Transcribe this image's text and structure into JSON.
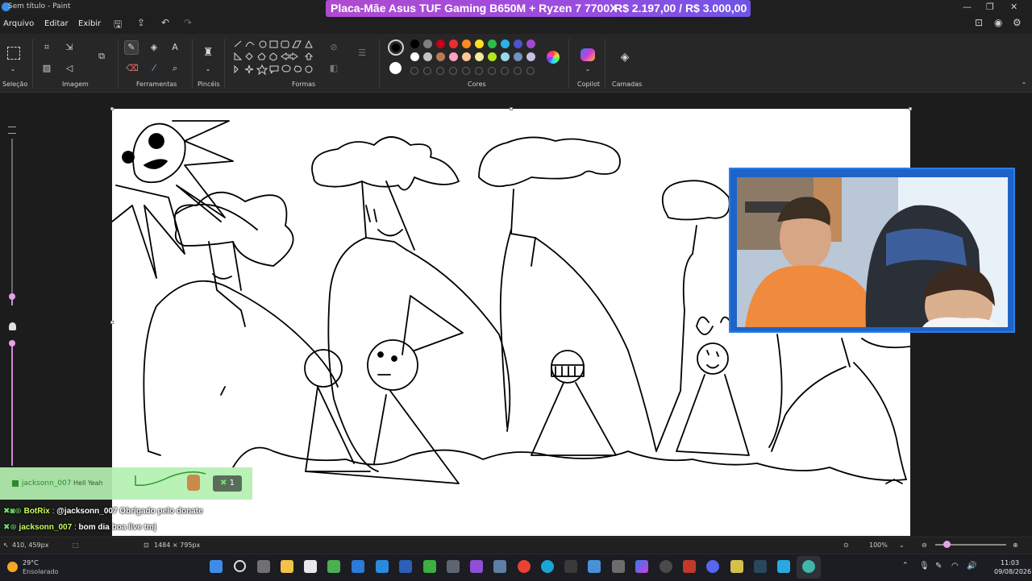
{
  "window": {
    "title": "Sem título - Paint",
    "promo_title": "Placa-Mãe Asus TUF Gaming B650M + Ryzen 7 7700X",
    "promo_price": "R$ 2.197,00 / R$ 3.000,00",
    "controls": [
      "—",
      "❐",
      "✕"
    ]
  },
  "menu": [
    "Arquivo",
    "Editar",
    "Exibir"
  ],
  "ribbon": {
    "groups": [
      "Seleção",
      "Imagem",
      "Ferramentas",
      "Pincéis",
      "Formas",
      "Cores",
      "Copilot",
      "Camadas"
    ]
  },
  "colors": {
    "primary": "#000000",
    "secondary": "#ffffff",
    "palette_row1": [
      "#000000",
      "#7f7f7f",
      "#c3001a",
      "#ef2b32",
      "#ff8a1f",
      "#ffe11a",
      "#2bbf4a",
      "#2ab3e6",
      "#4b53cf",
      "#a04ad0"
    ],
    "palette_row2": [
      "#ffffff",
      "#c3c3c3",
      "#b97a57",
      "#ff9fc3",
      "#ffc891",
      "#f3eba0",
      "#b5e61d",
      "#99d9ea",
      "#7092be",
      "#c8bfe7"
    ]
  },
  "alert": {
    "user": "jacksonn_007",
    "message": "Hell Yeah",
    "badge": "1"
  },
  "chat": [
    {
      "user": "BotRix",
      "message": "@jacksonn_007 Obrigado pelo donate"
    },
    {
      "user": "jacksonn_007",
      "message": "bom dia boa live tmj"
    }
  ],
  "status": {
    "cursor": "410, 459px",
    "size": "1484 × 795px",
    "zoom": "100%"
  },
  "taskbar": {
    "weather_temp": "29°C",
    "weather_desc": "Ensolarado",
    "time": "11:03",
    "date": "09/08/2026"
  }
}
